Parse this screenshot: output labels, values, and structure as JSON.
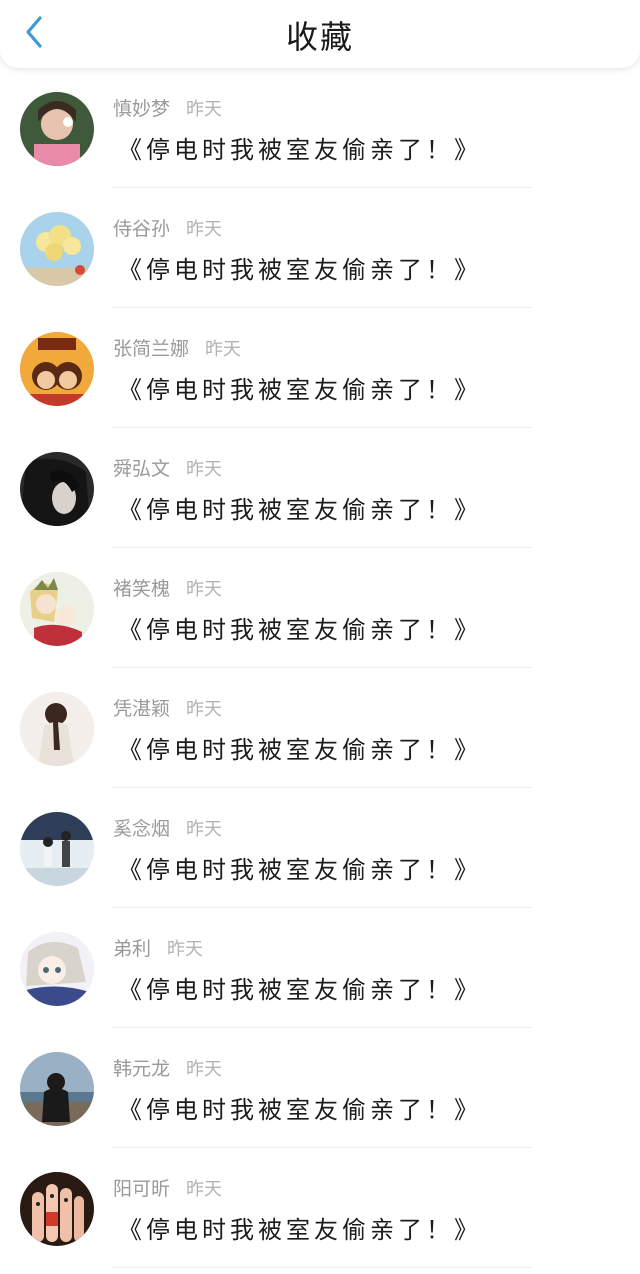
{
  "header": {
    "title": "收藏",
    "back_icon": "chevron-left-icon",
    "accent": "#3a9bd9"
  },
  "items": [
    {
      "name": "慎妙梦",
      "time": "昨天",
      "text": "《停电时我被室友偷亲了！》",
      "avatar": "avatar-photo-girl"
    },
    {
      "name": "侍谷孙",
      "time": "昨天",
      "text": "《停电时我被室友偷亲了！》",
      "avatar": "avatar-balloons"
    },
    {
      "name": "张简兰娜",
      "time": "昨天",
      "text": "《停电时我被室友偷亲了！》",
      "avatar": "avatar-cartoon-twins"
    },
    {
      "name": "舜弘文",
      "time": "昨天",
      "text": "《停电时我被室友偷亲了！》",
      "avatar": "avatar-dark-hair"
    },
    {
      "name": "褚笑槐",
      "time": "昨天",
      "text": "《停电时我被室友偷亲了！》",
      "avatar": "avatar-anime-elf"
    },
    {
      "name": "凭湛颖",
      "time": "昨天",
      "text": "《停电时我被室友偷亲了！》",
      "avatar": "avatar-girl-back"
    },
    {
      "name": "奚念烟",
      "time": "昨天",
      "text": "《停电时我被室友偷亲了！》",
      "avatar": "avatar-couple-sketch"
    },
    {
      "name": "弟利",
      "time": "昨天",
      "text": "《停电时我被室友偷亲了！》",
      "avatar": "avatar-anime-girl"
    },
    {
      "name": "韩元龙",
      "time": "昨天",
      "text": "《停电时我被室友偷亲了！》",
      "avatar": "avatar-beach-girl"
    },
    {
      "name": "阳可昕",
      "time": "昨天",
      "text": "《停电时我被室友偷亲了！》",
      "avatar": "avatar-finger-faces"
    }
  ]
}
